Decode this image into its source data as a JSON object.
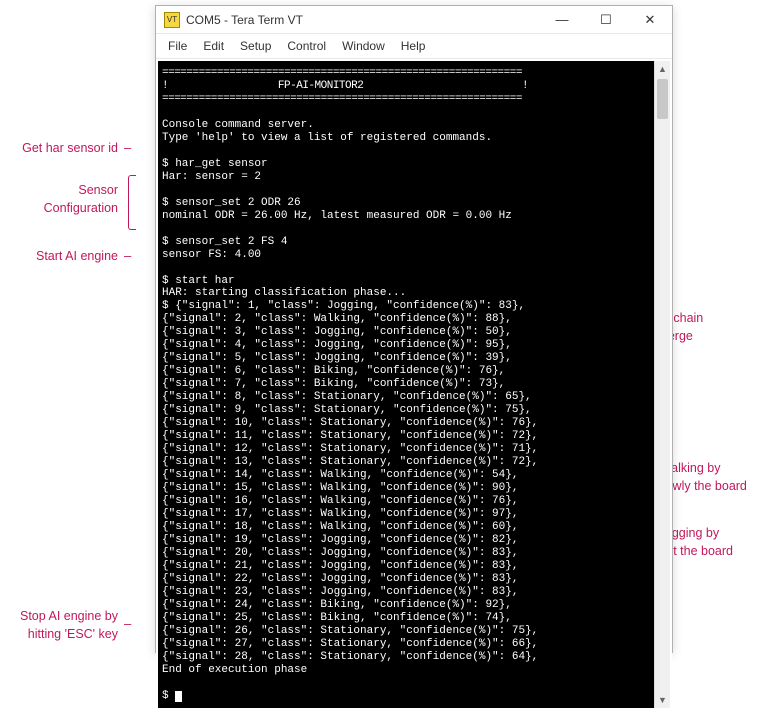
{
  "window": {
    "title": "COM5 - Tera Term VT",
    "icon_text": "VT",
    "min": "—",
    "max": "☐",
    "close": "✕"
  },
  "menu": {
    "file": "File",
    "edit": "Edit",
    "setup": "Setup",
    "control": "Control",
    "window": "Window",
    "help": "Help"
  },
  "annotations": {
    "get_sensor": "Get har sensor id",
    "sensor_config_l1": "Sensor",
    "sensor_config_l2": "Configuration",
    "start_ai": "Start AI engine",
    "stop_ai_l1": "Stop AI engine by",
    "stop_ai_l2": "hitting 'ESC' key",
    "preproc_l1": "Preprocessing chain",
    "preproc_l2": "needs to converge",
    "walk_l1": "Simulate walking by",
    "walk_l2": "shaking slowly the board",
    "jog_l1": "Simulate jogging by",
    "jog_l2": "shaking fast the board"
  },
  "terminal": {
    "rule": "===========================================================",
    "banner": "!                  FP-AI-MONITOR2                          !",
    "console1": "Console command server.",
    "console2": "Type 'help' to view a list of registered commands.",
    "cmd_har_get": "$ har_get sensor",
    "har_get_out": "Har: sensor = 2",
    "cmd_sensor_odr": "$ sensor_set 2 ODR 26",
    "sensor_odr_out": "nominal ODR = 26.00 Hz, latest measured ODR = 0.00 Hz",
    "cmd_sensor_fs": "$ sensor_set 2 FS 4",
    "sensor_fs_out": "sensor FS: 4.00",
    "cmd_start": "$ start har",
    "start_out": "HAR: starting classification phase...",
    "rows": [
      "$ {\"signal\": 1, \"class\": Jogging, \"confidence(%)\": 83},",
      "{\"signal\": 2, \"class\": Walking, \"confidence(%)\": 88},",
      "{\"signal\": 3, \"class\": Jogging, \"confidence(%)\": 50},",
      "{\"signal\": 4, \"class\": Jogging, \"confidence(%)\": 95},",
      "{\"signal\": 5, \"class\": Jogging, \"confidence(%)\": 39},",
      "{\"signal\": 6, \"class\": Biking, \"confidence(%)\": 76},",
      "{\"signal\": 7, \"class\": Biking, \"confidence(%)\": 73},",
      "{\"signal\": 8, \"class\": Stationary, \"confidence(%)\": 65},",
      "{\"signal\": 9, \"class\": Stationary, \"confidence(%)\": 75},",
      "{\"signal\": 10, \"class\": Stationary, \"confidence(%)\": 76},",
      "{\"signal\": 11, \"class\": Stationary, \"confidence(%)\": 72},",
      "{\"signal\": 12, \"class\": Stationary, \"confidence(%)\": 71},",
      "{\"signal\": 13, \"class\": Stationary, \"confidence(%)\": 72},",
      "{\"signal\": 14, \"class\": Walking, \"confidence(%)\": 54},",
      "{\"signal\": 15, \"class\": Walking, \"confidence(%)\": 90},",
      "{\"signal\": 16, \"class\": Walking, \"confidence(%)\": 76},",
      "{\"signal\": 17, \"class\": Walking, \"confidence(%)\": 97},",
      "{\"signal\": 18, \"class\": Walking, \"confidence(%)\": 60},",
      "{\"signal\": 19, \"class\": Jogging, \"confidence(%)\": 82},",
      "{\"signal\": 20, \"class\": Jogging, \"confidence(%)\": 83},",
      "{\"signal\": 21, \"class\": Jogging, \"confidence(%)\": 83},",
      "{\"signal\": 22, \"class\": Jogging, \"confidence(%)\": 83},",
      "{\"signal\": 23, \"class\": Jogging, \"confidence(%)\": 83},",
      "{\"signal\": 24, \"class\": Biking, \"confidence(%)\": 92},",
      "{\"signal\": 25, \"class\": Biking, \"confidence(%)\": 74},",
      "{\"signal\": 26, \"class\": Stationary, \"confidence(%)\": 75},",
      "{\"signal\": 27, \"class\": Stationary, \"confidence(%)\": 66},",
      "{\"signal\": 28, \"class\": Stationary, \"confidence(%)\": 64},"
    ],
    "end": "End of execution phase",
    "prompt": "$ "
  }
}
